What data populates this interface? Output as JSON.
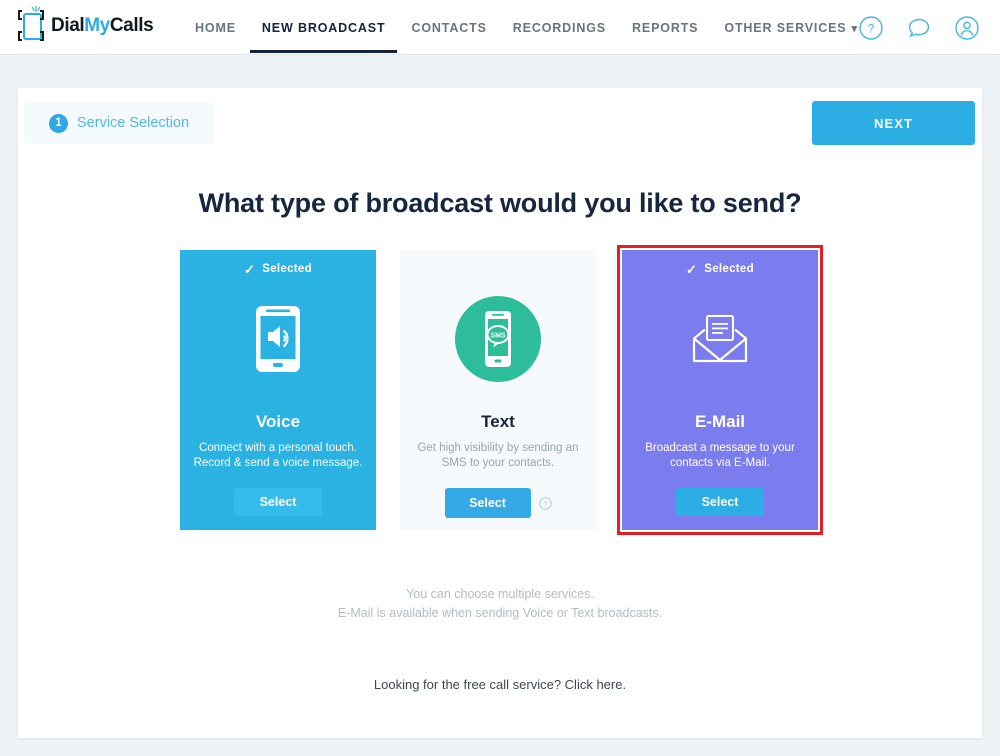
{
  "brand": {
    "name_part1": "Dial",
    "name_part2": "My",
    "name_part3": "Calls",
    "accent": "#29ace3"
  },
  "nav": {
    "items": [
      {
        "label": "HOME",
        "active": false
      },
      {
        "label": "NEW BROADCAST",
        "active": true
      },
      {
        "label": "CONTACTS",
        "active": false
      },
      {
        "label": "RECORDINGS",
        "active": false
      },
      {
        "label": "REPORTS",
        "active": false
      },
      {
        "label": "OTHER SERVICES",
        "active": false,
        "caret": "⌄"
      }
    ],
    "icons": [
      {
        "name": "help-icon"
      },
      {
        "name": "chat-icon"
      },
      {
        "name": "account-icon"
      }
    ]
  },
  "step": {
    "number": "1",
    "label": "Service Selection"
  },
  "toolbar": {
    "next_label": "NEXT"
  },
  "main": {
    "headline": "What type of broadcast would you like to send?",
    "note_line1": "You can choose multiple services.",
    "note_line2": "E-Mail is available when sending Voice or Text broadcasts.",
    "free_call": "Looking for the free call service? Click here."
  },
  "cards": [
    {
      "id": "voice",
      "title": "Voice",
      "desc_line1": "Connect with a personal touch.",
      "desc_line2": "Record & send a voice message.",
      "select_label": "Select",
      "selected_label": "Selected",
      "selected": true,
      "bg": "#29b2e2",
      "icon": "phone-speaker-icon",
      "has_help": false,
      "highlighted": false
    },
    {
      "id": "text",
      "title": "Text",
      "desc_line1": "Get high visibility by sending an",
      "desc_line2": "SMS to your contacts.",
      "select_label": "Select",
      "selected_label": "",
      "selected": false,
      "bg": "#f7fafc",
      "icon": "phone-sms-icon",
      "has_help": true,
      "highlighted": false
    },
    {
      "id": "email",
      "title": "E-Mail",
      "desc_line1": "Broadcast a message to your",
      "desc_line2": "contacts via E-Mail.",
      "select_label": "Select",
      "selected_label": "Selected",
      "selected": true,
      "bg": "#7b7cee",
      "icon": "envelope-icon",
      "has_help": false,
      "highlighted": true,
      "highlight_color": "#e41e26"
    }
  ]
}
